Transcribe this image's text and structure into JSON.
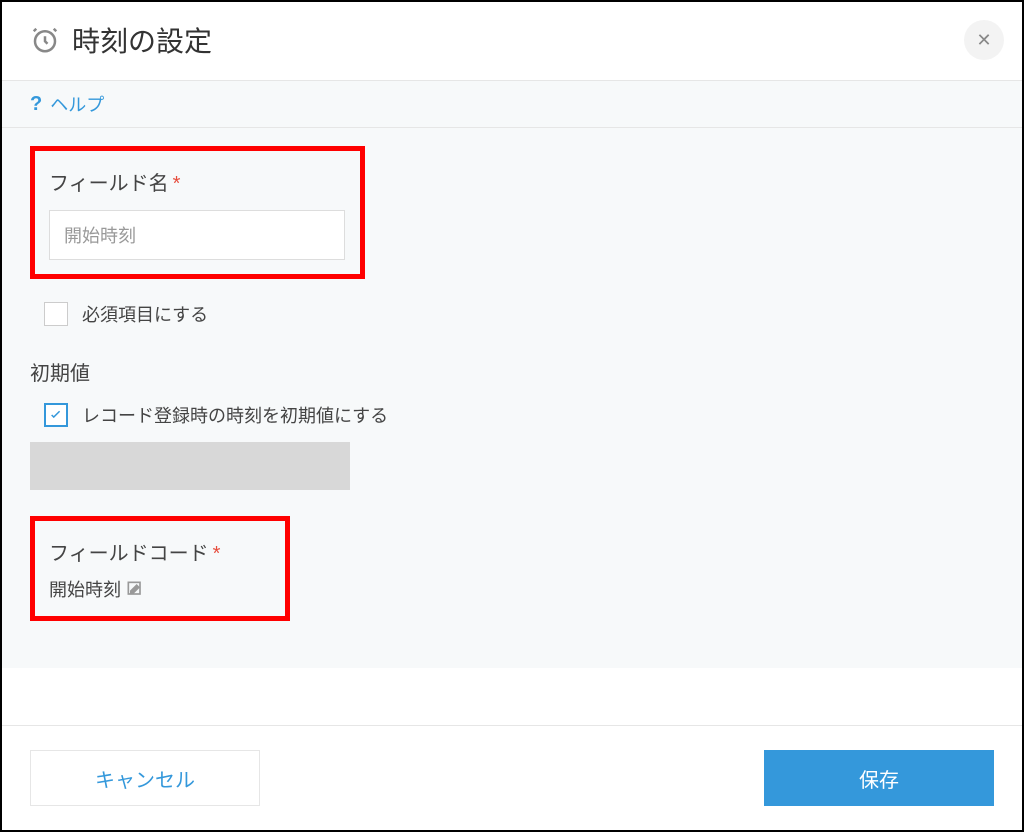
{
  "header": {
    "title": "時刻の設定"
  },
  "help": {
    "label": "ヘルプ"
  },
  "fieldName": {
    "label": "フィールド名",
    "value": "開始時刻"
  },
  "requiredCheckbox": {
    "label": "必須項目にする",
    "checked": false
  },
  "defaultValue": {
    "label": "初期値",
    "useRecordTimeLabel": "レコード登録時の時刻を初期値にする",
    "useRecordTimeChecked": true
  },
  "fieldCode": {
    "label": "フィールドコード",
    "value": "開始時刻"
  },
  "footer": {
    "cancel": "キャンセル",
    "save": "保存"
  }
}
